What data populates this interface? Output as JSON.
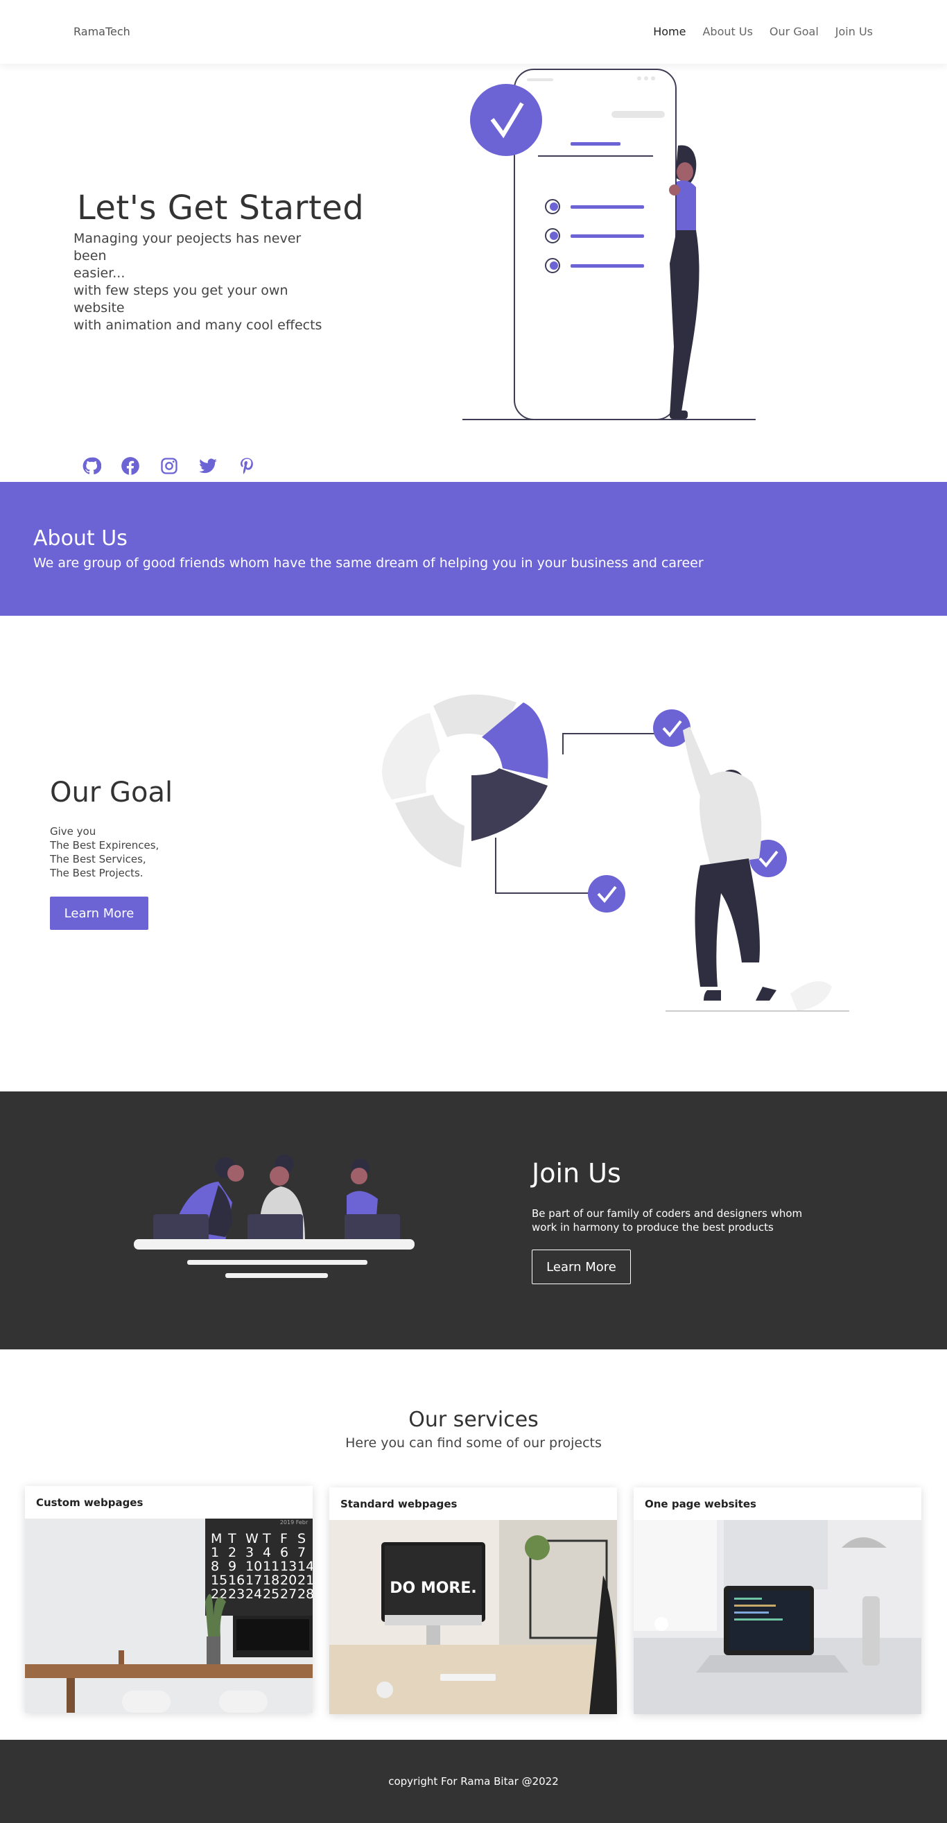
{
  "nav": {
    "brand": "RamaTech",
    "links": [
      "Home",
      "About Us",
      "Our Goal",
      "Join Us"
    ]
  },
  "hero": {
    "title": "Let's Get Started",
    "lines": [
      "Managing your peojects has never been",
      "easier...",
      "with few steps you get your own website",
      "with animation and many cool effects"
    ],
    "socials": [
      "github-icon",
      "facebook-icon",
      "instagram-icon",
      "twitter-icon",
      "pinterest-icon"
    ]
  },
  "about": {
    "title": "About Us",
    "text": "We are group of good friends whom have the same dream of helping you in your business and career"
  },
  "goal": {
    "title": "Our Goal",
    "lines": [
      "Give you",
      "The Best Expirences,",
      "The Best Services,",
      "The Best Projects."
    ],
    "button": "Learn More"
  },
  "join": {
    "title": "Join Us",
    "text": "Be part of our family of coders and designers whom work in harmony to produce the best products",
    "button": "Learn More"
  },
  "services": {
    "title": "Our services",
    "subtitle": "Here you can find some of our projects",
    "cards": [
      {
        "title": "Custom webpages",
        "calendar": [
          "M",
          "T",
          "W",
          "T",
          "F",
          "S",
          "1",
          "2",
          "3",
          "4",
          "6",
          "7",
          "8",
          "9",
          "10",
          "11",
          "13",
          "14",
          "15",
          "16",
          "17",
          "18",
          "20",
          "21",
          "22",
          "23",
          "24",
          "25",
          "27",
          "28"
        ],
        "calendar_header": "2019 Febr"
      },
      {
        "title": "Standard webpages",
        "poster": "DO MORE."
      },
      {
        "title": "One page websites"
      }
    ]
  },
  "footer": {
    "text": "copyright For Rama Bitar @2022"
  },
  "colors": {
    "accent": "#6c63d5",
    "dark": "#333333"
  }
}
